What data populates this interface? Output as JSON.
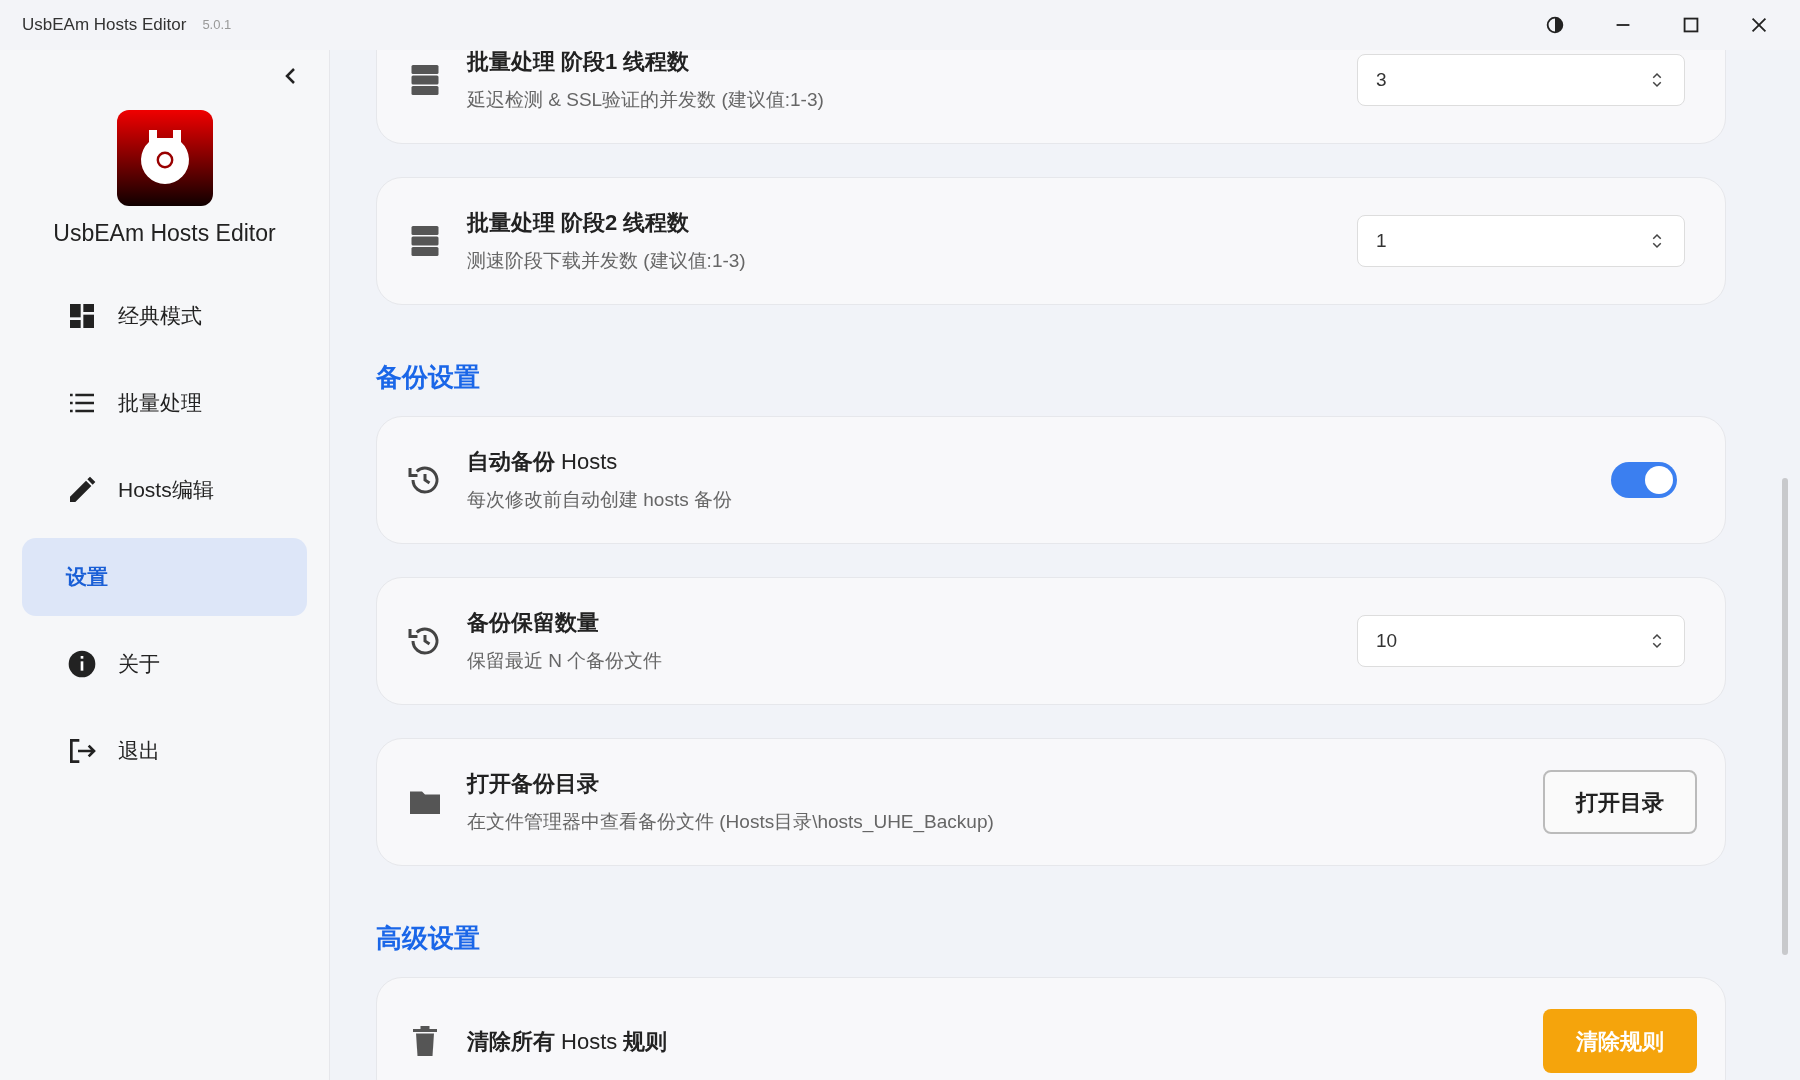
{
  "window": {
    "title": "UsbEAm Hosts Editor",
    "version": "5.0.1"
  },
  "sidebar": {
    "app_name": "UsbEAm Hosts Editor",
    "items": [
      {
        "label": "经典模式",
        "selected": false
      },
      {
        "label": "批量处理",
        "selected": false
      },
      {
        "label": "Hosts编辑",
        "selected": false
      },
      {
        "label": "设置",
        "selected": true
      },
      {
        "label": "关于",
        "selected": false
      },
      {
        "label": "退出",
        "selected": false
      }
    ]
  },
  "sections": [
    {
      "cards": [
        {
          "kind": "spinner",
          "title": "批量处理 阶段1 线程数",
          "description": "延迟检测 & SSL验证的并发数 (建议值:1-3)",
          "value": "3"
        },
        {
          "kind": "spinner",
          "title": "批量处理 阶段2 线程数",
          "description": "测速阶段下载并发数 (建议值:1-3)",
          "value": "1"
        }
      ]
    },
    {
      "heading": "备份设置",
      "cards": [
        {
          "kind": "toggle",
          "title": "**自动备份** Hosts",
          "description": "每次修改前自动创建 hosts 备份",
          "on": true
        },
        {
          "kind": "spinner",
          "title": "备份保留数量",
          "description": "保留最近 N 个备份文件",
          "value": "10"
        },
        {
          "kind": "button",
          "title": "打开备份目录",
          "description": "在文件管理器中查看备份文件 (Hosts目录\\hosts_UHE_Backup)",
          "button": "打开目录"
        }
      ]
    },
    {
      "heading": "高级设置",
      "cards": [
        {
          "kind": "danger",
          "title": "**清除所有** Hosts **规则**",
          "button": "清除规则"
        }
      ]
    }
  ]
}
